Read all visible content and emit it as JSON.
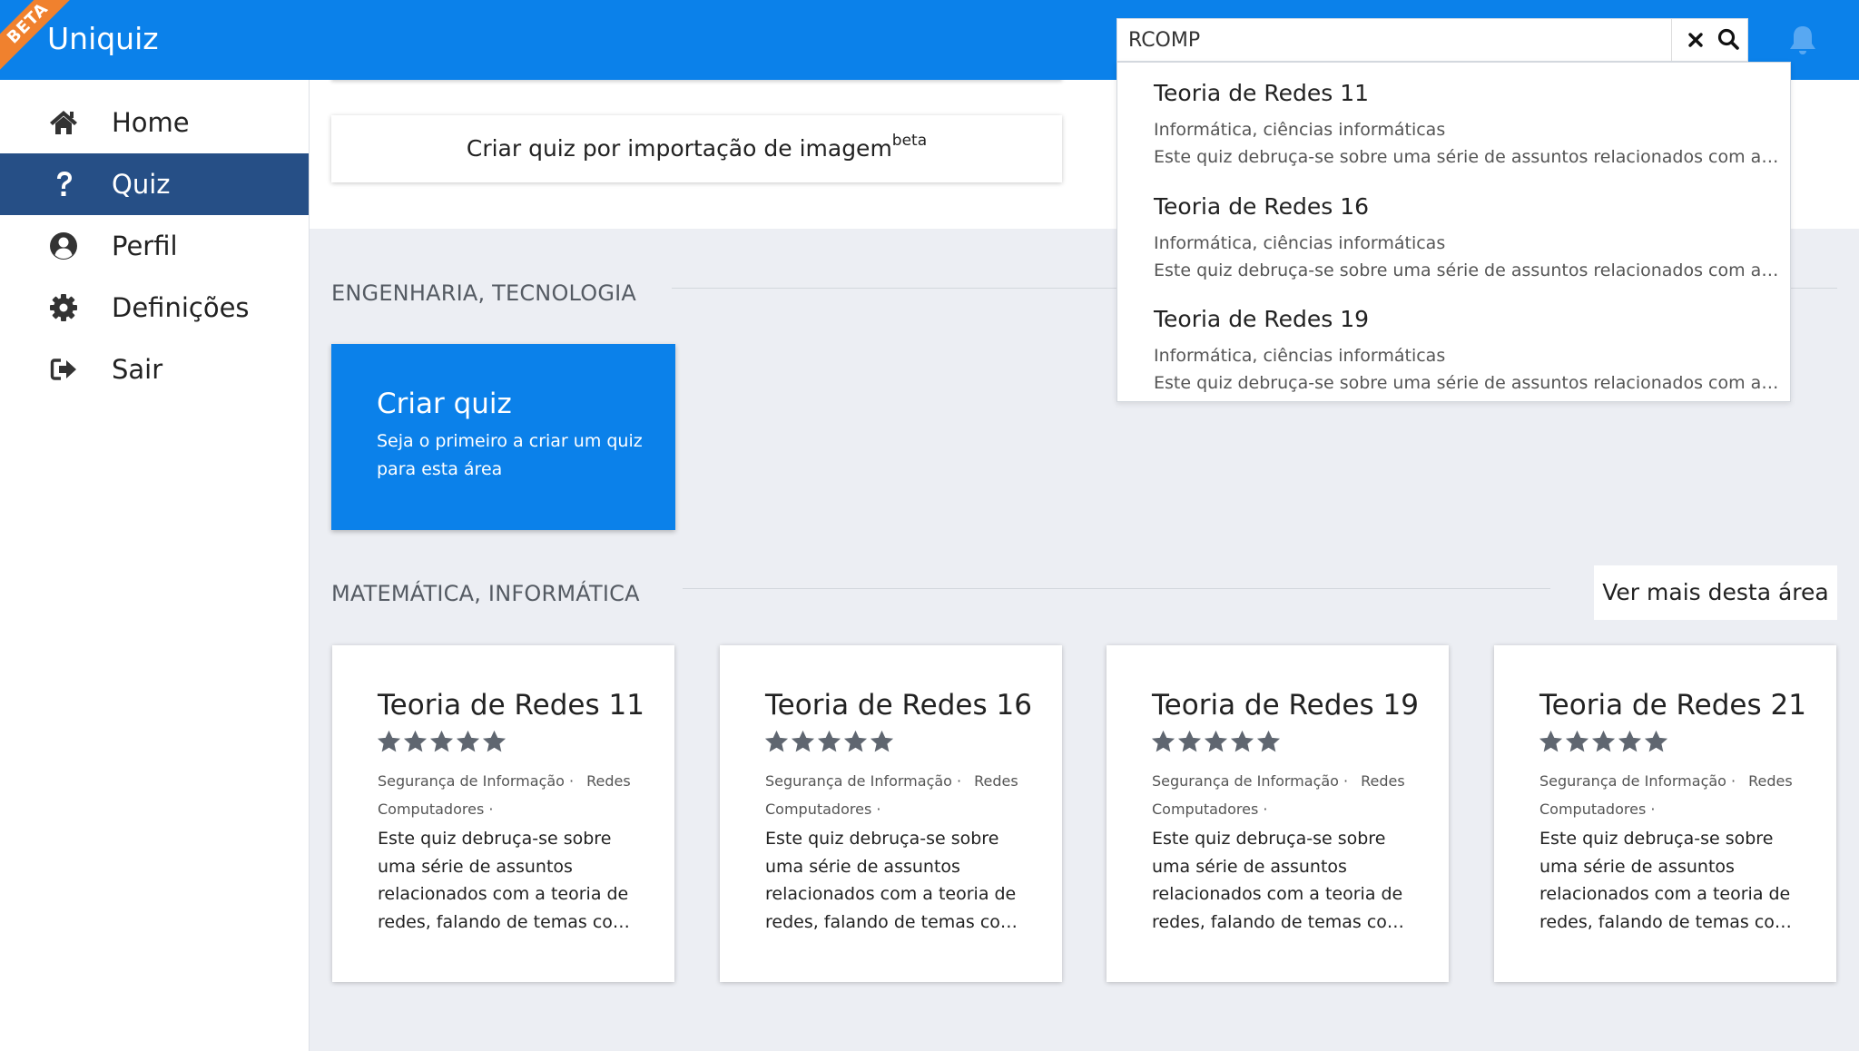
{
  "brand": {
    "beta_badge": "BETA",
    "name": "Uniquiz"
  },
  "search": {
    "value": "RCOMP",
    "placeholder": ""
  },
  "sidebar": {
    "items": [
      {
        "label": "Home",
        "icon": "home-icon",
        "active": false
      },
      {
        "label": "Quiz",
        "icon": "question-icon",
        "active": true
      },
      {
        "label": "Perfil",
        "icon": "user-circle-icon",
        "active": false
      },
      {
        "label": "Definições",
        "icon": "gear-icon",
        "active": false
      },
      {
        "label": "Sair",
        "icon": "sign-out-icon",
        "active": false
      }
    ]
  },
  "main": {
    "import_button": {
      "label": "Criar quiz por importação de imagem",
      "badge": "beta"
    },
    "sections": [
      {
        "title": "ENGENHARIA, TECNOLOGIA",
        "create_card": {
          "title": "Criar quiz",
          "subtitle": "Seja o primeiro a criar um quiz para esta área"
        }
      },
      {
        "title": "MATEMÁTICA, INFORMÁTICA",
        "more_button": "Ver mais desta área",
        "cards": [
          {
            "title": "Teoria de Redes 11",
            "rating": 5,
            "tags": [
              "Segurança de Informação ·",
              "Redes",
              "Computadores ·"
            ],
            "description": "Este quiz debruça-se sobre uma série de assuntos relacionados com a teoria de redes, falando de temas co…"
          },
          {
            "title": "Teoria de Redes 16",
            "rating": 5,
            "tags": [
              "Segurança de Informação ·",
              "Redes",
              "Computadores ·"
            ],
            "description": "Este quiz debruça-se sobre uma série de assuntos relacionados com a teoria de redes, falando de temas co…"
          },
          {
            "title": "Teoria de Redes 19",
            "rating": 5,
            "tags": [
              "Segurança de Informação ·",
              "Redes",
              "Computadores ·"
            ],
            "description": "Este quiz debruça-se sobre uma série de assuntos relacionados com a teoria de redes, falando de temas co…"
          },
          {
            "title": "Teoria de Redes 21",
            "rating": 5,
            "tags": [
              "Segurança de Informação ·",
              "Redes",
              "Computadores ·"
            ],
            "description": "Este quiz debruça-se sobre uma série de assuntos relacionados com a teoria de redes, falando de temas co…"
          }
        ]
      }
    ]
  },
  "suggestions": [
    {
      "title": "Teoria de Redes 11",
      "category": "Informática, ciências informáticas",
      "description": "Este quiz debruça-se sobre uma série de assuntos relacionados com a…"
    },
    {
      "title": "Teoria de Redes 16",
      "category": "Informática, ciências informáticas",
      "description": "Este quiz debruça-se sobre uma série de assuntos relacionados com a…"
    },
    {
      "title": "Teoria de Redes 19",
      "category": "Informática, ciências informáticas",
      "description": "Este quiz debruça-se sobre uma série de assuntos relacionados com a…"
    }
  ],
  "colors": {
    "primary": "#0b81ea",
    "sidebar_active": "#264f86",
    "beta_ribbon": "#f0812e",
    "star": "#5f6670",
    "background": "#eceef3"
  }
}
